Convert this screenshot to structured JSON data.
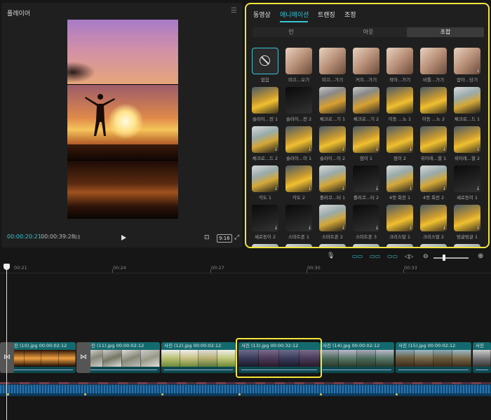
{
  "player": {
    "title": "플레이어",
    "current_time": "00:00:20:21",
    "total_time": "00:00:39:28",
    "ratio": "9:16"
  },
  "effects": {
    "tabs": [
      "동영상",
      "애니메이션",
      "트랜징",
      "조정"
    ],
    "active_tab": "애니메이션",
    "subtabs": [
      "인",
      "아웃",
      "조합"
    ],
    "active_subtab": "조합",
    "items": [
      {
        "label": "없음",
        "style": "none",
        "download": false
      },
      {
        "label": "미끄...오기",
        "style": "warm",
        "download": false
      },
      {
        "label": "미끄...가기",
        "style": "warm",
        "download": false
      },
      {
        "label": "커지...가기",
        "style": "warm",
        "download": false
      },
      {
        "label": "작아...가기",
        "style": "warm",
        "download": false
      },
      {
        "label": "비틀...가기",
        "style": "warm",
        "download": false
      },
      {
        "label": "잡아...당기",
        "style": "warm",
        "download": true
      },
      {
        "label": "슬라이...전 1",
        "style": "gold",
        "download": false
      },
      {
        "label": "슬라이...전 2",
        "style": "dark",
        "download": false
      },
      {
        "label": "체크로...기 1",
        "style": "mix",
        "download": false
      },
      {
        "label": "체크로...기 2",
        "style": "mix",
        "download": false
      },
      {
        "label": "이동 ...노 1",
        "style": "gold",
        "download": false
      },
      {
        "label": "이동 ...노 2",
        "style": "gold",
        "download": false
      },
      {
        "label": "체크로...드 1",
        "style": "tree",
        "download": false
      },
      {
        "label": "체크로...드 2",
        "style": "tree",
        "download": true
      },
      {
        "label": "슬라이...이 1",
        "style": "gold",
        "download": true
      },
      {
        "label": "슬라이...이 2",
        "style": "gold",
        "download": true
      },
      {
        "label": "점이 1",
        "style": "gold",
        "download": true
      },
      {
        "label": "점이 2",
        "style": "gold",
        "download": true
      },
      {
        "label": "위아래...할 1",
        "style": "gold",
        "download": true
      },
      {
        "label": "위아래...할 2",
        "style": "gold",
        "download": true
      },
      {
        "label": "각도 1",
        "style": "tree",
        "download": true
      },
      {
        "label": "각도 2",
        "style": "gold",
        "download": true
      },
      {
        "label": "롤러코...터 1",
        "style": "tree",
        "download": true
      },
      {
        "label": "롤러코...터 2",
        "style": "dark",
        "download": true
      },
      {
        "label": "4컷 회전 1",
        "style": "tree",
        "download": true
      },
      {
        "label": "4컷 회전 2",
        "style": "tree",
        "download": true
      },
      {
        "label": "세로동이 1",
        "style": "dark",
        "download": true
      },
      {
        "label": "세로동이 2",
        "style": "dark",
        "download": true
      },
      {
        "label": "스마트폰 1",
        "style": "dark",
        "download": true
      },
      {
        "label": "스마트폰 2",
        "style": "tree",
        "download": true
      },
      {
        "label": "스마트폰 3",
        "style": "dark",
        "download": true
      },
      {
        "label": "크리스탈 1",
        "style": "gold",
        "download": true
      },
      {
        "label": "크리스탈 2",
        "style": "gold",
        "download": true
      },
      {
        "label": "빙글빙글 1",
        "style": "gold",
        "download": true
      },
      {
        "label": "",
        "style": "tree",
        "download": false
      },
      {
        "label": "",
        "style": "tree",
        "download": false
      },
      {
        "label": "",
        "style": "tree",
        "download": false
      },
      {
        "label": "",
        "style": "tree",
        "download": false
      },
      {
        "label": "",
        "style": "tree",
        "download": false
      },
      {
        "label": "",
        "style": "tree",
        "download": false
      },
      {
        "label": "",
        "style": "tree",
        "download": false
      }
    ]
  },
  "timeline": {
    "ruler": [
      "00:21",
      "00:24",
      "00:27",
      "00:30",
      "00:33"
    ],
    "clips": [
      {
        "name": "사진 (10).jpg",
        "duration": "00:00:02:12"
      },
      {
        "name": "사진 (11).jpg",
        "duration": "00:00:02:12"
      },
      {
        "name": "사진 (12).jpg",
        "duration": "00:00:02:12"
      },
      {
        "name": "사진 (13).jpg",
        "duration": "00:00:32:12"
      },
      {
        "name": "사진 (14).jpg",
        "duration": "00:00:02:12"
      },
      {
        "name": "사진 (15).jpg",
        "duration": "00:00:02:12"
      },
      {
        "name": "사진",
        "duration": ""
      }
    ]
  },
  "colors": {
    "accent": "#35c6d6",
    "highlight": "#f4e43a",
    "clip": "#0f5a5e",
    "audio": "#0d3a5a"
  }
}
